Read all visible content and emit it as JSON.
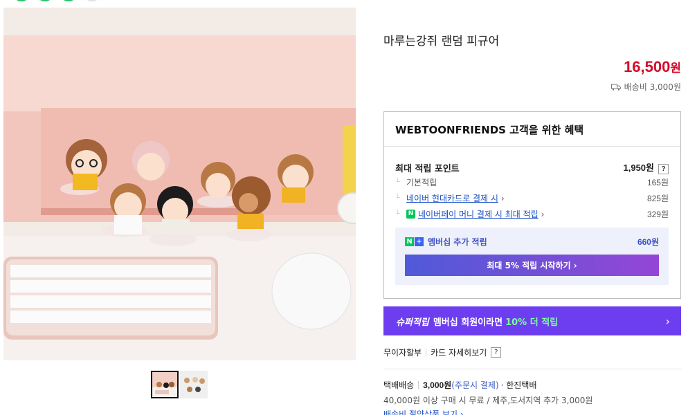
{
  "product": {
    "title": "마루는강쥐 랜덤 피규어",
    "price": "16,500",
    "price_unit": "원",
    "shipping_fee": "배송비 3,000원"
  },
  "benefits": {
    "header": "WEBTOONFRIENDS 고객을 위한 혜택",
    "max_points_label": "최대 적립 포인트",
    "max_points_value": "1,950원",
    "help_mark": "?",
    "basic_label": "기본적립",
    "basic_value": "165원",
    "card_label": "네이버 현대카드로 결제 시",
    "card_value": "825원",
    "npay_label": "네이버페이 머니 결제 시 최대 적립",
    "npay_value": "329원",
    "chevron": "›",
    "membership_label": "멤버십 추가 적립",
    "membership_value": "660원",
    "membership_button": "최대 5% 적립 시작하기 ›"
  },
  "super_banner": {
    "brand": "슈퍼적립",
    "text": "멤버십 회원이라면",
    "highlight": "10% 더 적립",
    "chevron": "›"
  },
  "card_links": {
    "installment": "무이자할부",
    "card_detail": "카드 자세히보기",
    "help_mark": "?"
  },
  "delivery": {
    "label": "택배배송",
    "fee": "3,000원",
    "payment_note": "(주문시 결제)",
    "carrier": "· 한진택배",
    "free_note": "40,000원 이상 구매 시 무료 / 제주,도서지역 추가 3,000원",
    "bundle_link": "배송비 절약상품 보기 ›"
  },
  "colors": {
    "price_red": "#d60b2b",
    "membership_purple": "#6d3ef0",
    "link_blue": "#1c52c7",
    "naver_green": "#03c75a"
  },
  "icons": [
    "truck-icon",
    "question-icon",
    "chevron-right-icon",
    "npay-icon",
    "naver-plus-icon"
  ]
}
